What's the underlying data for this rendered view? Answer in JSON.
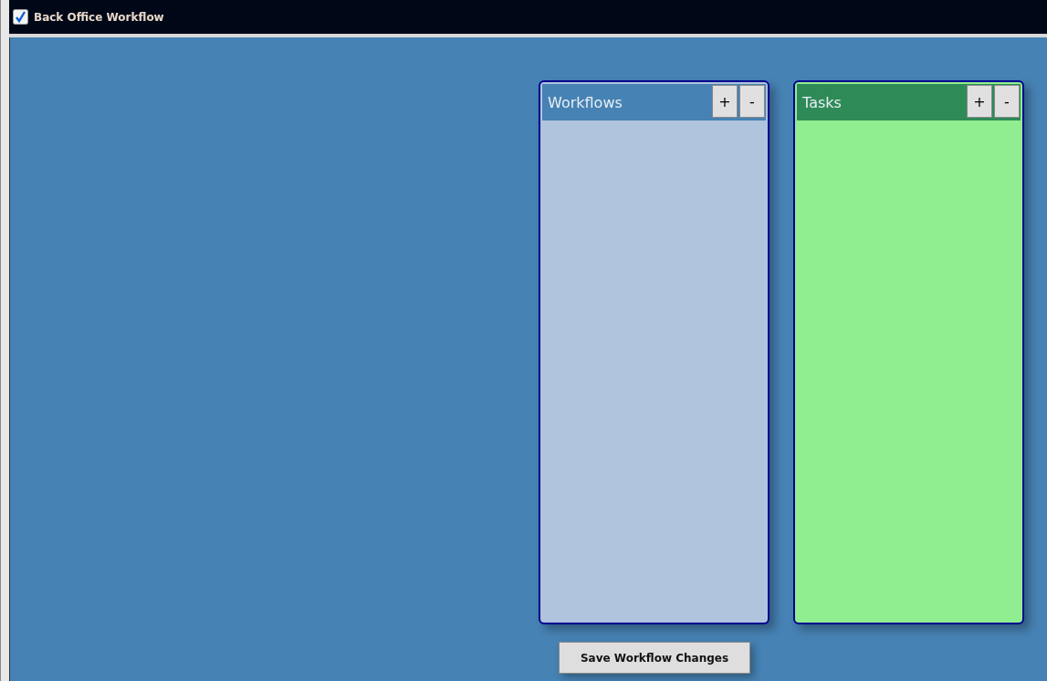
{
  "window": {
    "title": "Back Office Workflow"
  },
  "panels": [
    {
      "header": {
        "title": "Workflows",
        "color": "#4682b4",
        "buttons": [
          "+",
          "-"
        ]
      },
      "color": "#b0c4de"
    },
    {
      "header": {
        "title": "Tasks",
        "color": "#2e8b57",
        "buttons": [
          "+",
          "-"
        ]
      },
      "color": "#90ee90"
    }
  ],
  "save_button": "Save Workflow Changes"
}
